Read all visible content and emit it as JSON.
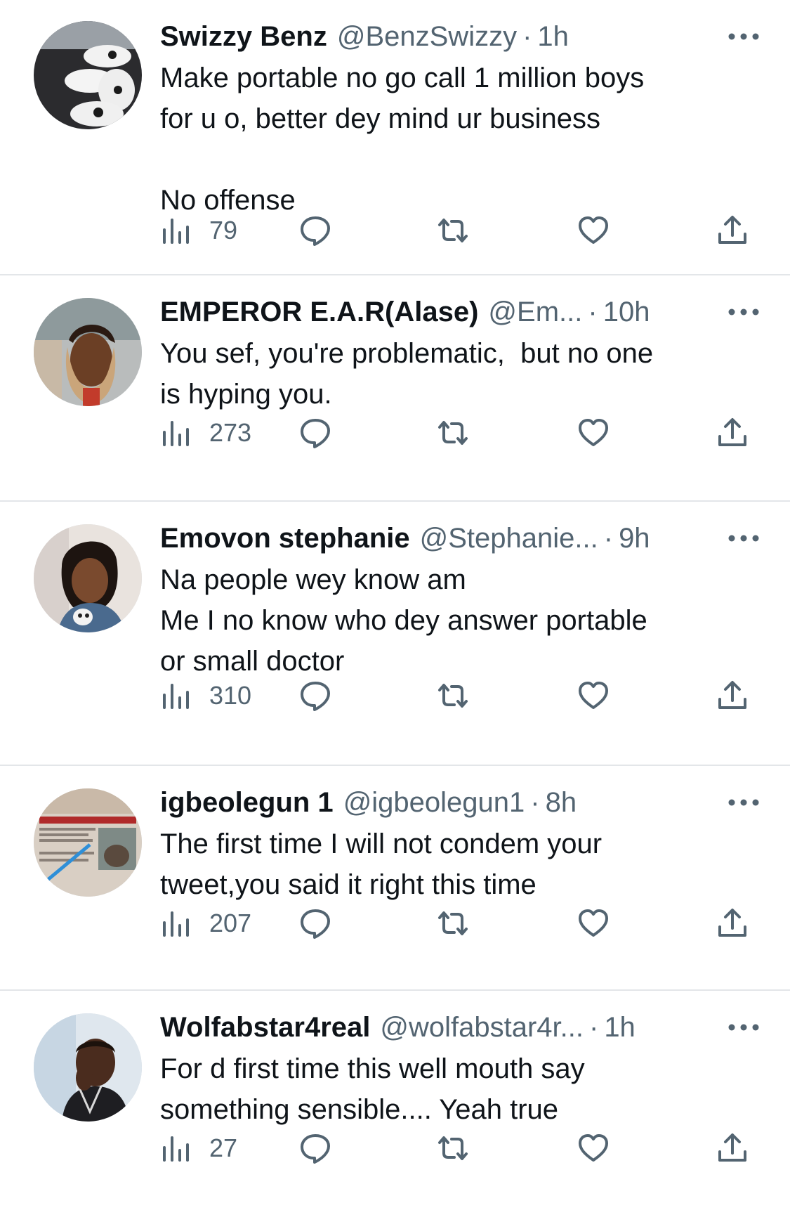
{
  "tweets": [
    {
      "name": "Swizzy Benz",
      "handle": "@BenzSwizzy",
      "separator": "·",
      "time": "1h",
      "text": "Make portable no go call 1 million boys\nfor u o, better dey mind ur business\n\nNo offense",
      "views": "79",
      "avatar_desc": "sneakers"
    },
    {
      "name": "EMPEROR E.A.R(Alase)",
      "handle": "@Em...",
      "separator": "·",
      "time": "10h",
      "text": "You sef, you're problematic,  but no one\nis hyping you.",
      "views": "273",
      "avatar_desc": "man-with-scarf"
    },
    {
      "name": "Emovon stephanie",
      "handle": "@Stephanie...",
      "separator": "·",
      "time": "9h",
      "text": "Na people wey know am\nMe I no know who dey answer portable\nor small doctor",
      "views": "310",
      "avatar_desc": "woman-selfie"
    },
    {
      "name": "igbeolegun 1",
      "handle": "@igbeolegun1",
      "separator": "·",
      "time": "8h",
      "text": "The first time I will not condem your\ntweet,you said it right this time",
      "views": "207",
      "avatar_desc": "newspaper"
    },
    {
      "name": "Wolfabstar4real",
      "handle": "@wolfabstar4r...",
      "separator": "·",
      "time": "1h",
      "text": "For d first time this well mouth say\nsomething sensible.... Yeah true",
      "views": "27",
      "avatar_desc": "man-portrait"
    }
  ],
  "icons": {
    "views": "views-icon",
    "reply": "reply-icon",
    "retweet": "retweet-icon",
    "like": "like-icon",
    "share": "share-icon",
    "more": "more-icon"
  },
  "colors": {
    "text": "#0f1419",
    "secondary": "#536471",
    "divider": "#e3e6e9"
  }
}
